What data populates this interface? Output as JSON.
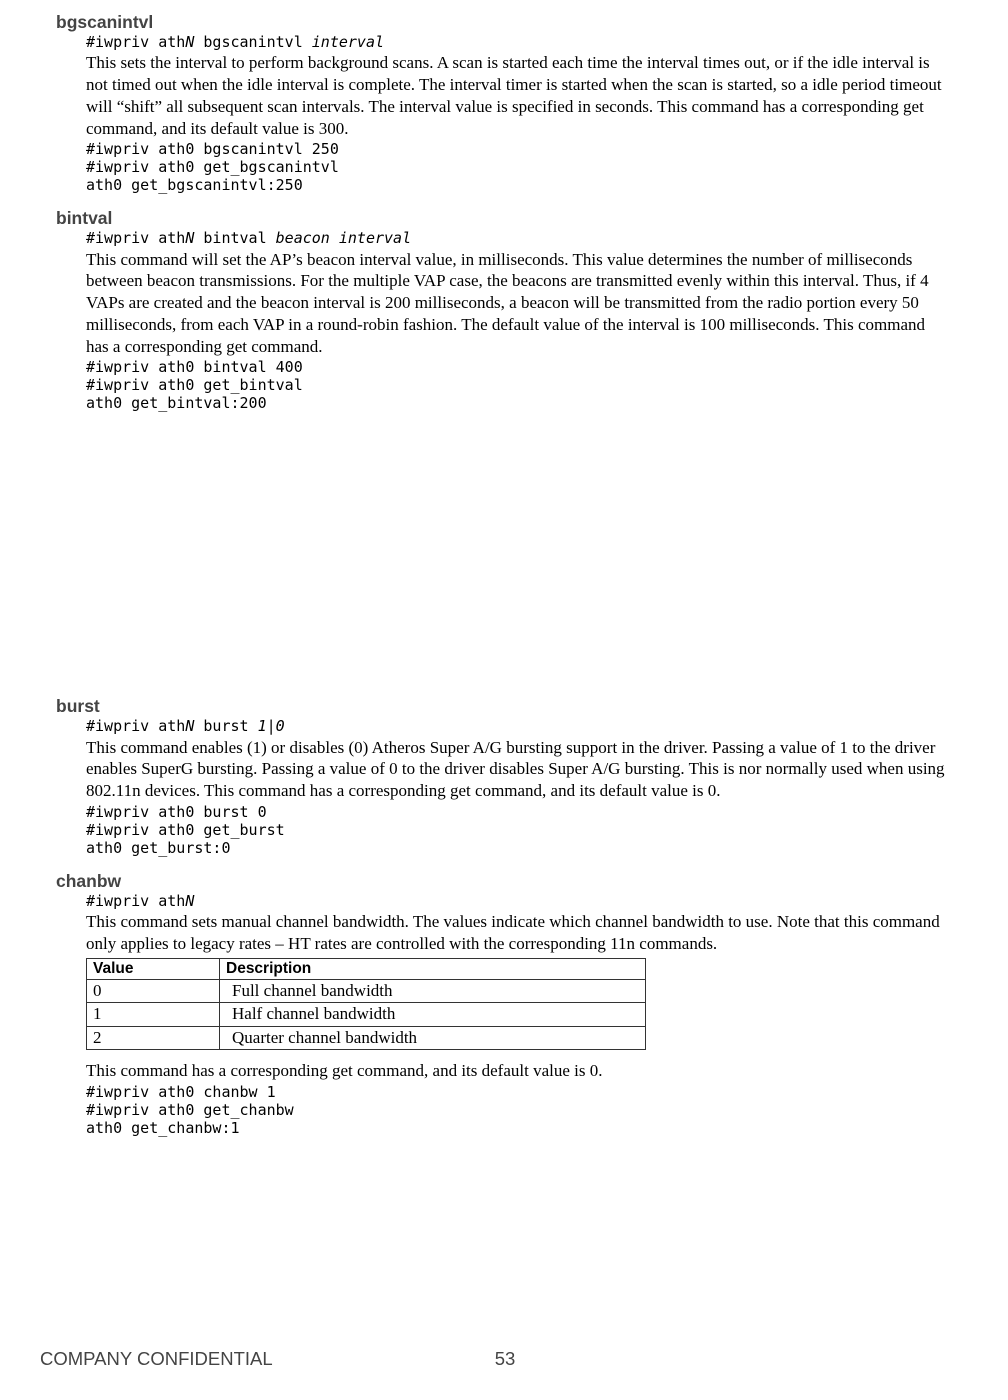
{
  "sections": {
    "bgscanintvl": {
      "heading": "bgscanintvl",
      "syntax_pre": "#iwpriv ath",
      "syntax_n": "N",
      "syntax_mid": " bgscanintvl ",
      "syntax_arg": "interval",
      "desc": "This sets the interval to perform background scans. A scan is started each time the interval times out, or if the idle interval is not timed out when the idle interval is complete. The interval timer is started when the scan is started, so a idle period timeout will “shift” all subsequent scan intervals. The interval value is specified in seconds. This command has a corresponding get command, and its default value is 300.",
      "example": "#iwpriv ath0 bgscanintvl 250\n#iwpriv ath0 get_bgscanintvl\nath0 get_bgscanintvl:250"
    },
    "bintval": {
      "heading": "bintval",
      "syntax_pre": "#iwpriv ath",
      "syntax_n": "N",
      "syntax_mid": " bintval ",
      "syntax_arg": "beacon interval",
      "desc": "This command will set the AP’s beacon interval value, in milliseconds. This value determines the number of milliseconds between beacon transmissions. For the multiple VAP case, the beacons are transmitted evenly within this interval. Thus, if 4 VAPs are created and the beacon interval is 200 milliseconds, a beacon will be transmitted from the radio portion every 50 milliseconds, from each VAP in a round-robin fashion. The default value of the interval is 100 milliseconds. This command has a corresponding get command.",
      "example": "#iwpriv ath0 bintval 400\n#iwpriv ath0 get_bintval\nath0 get_bintval:200"
    },
    "burst": {
      "heading": "burst",
      "syntax_pre": "#iwpriv ath",
      "syntax_n": "N",
      "syntax_mid": " burst ",
      "syntax_arg": "1|0",
      "desc": "This command enables (1) or disables (0) Atheros Super A/G bursting support in the driver. Passing a value of 1 to the driver enables SuperG bursting. Passing a value of 0 to the driver disables Super A/G bursting. This is nor normally used when using 802.11n devices. This command has a corresponding get command, and its default value is 0.",
      "example": "#iwpriv ath0 burst 0\n#iwpriv ath0 get_burst\nath0 get_burst:0"
    },
    "chanbw": {
      "heading": "chanbw",
      "syntax_pre": "#iwpriv ath",
      "syntax_n": "N",
      "desc": "This command sets manual channel bandwidth. The values indicate which channel bandwidth to use. Note that this command only applies to legacy rates – HT rates are controlled with the corresponding 11n commands.",
      "table": {
        "head_value": "Value",
        "head_desc": "Description",
        "rows": [
          {
            "value": "0",
            "desc": "Full channel bandwidth"
          },
          {
            "value": "1",
            "desc": "Half channel bandwidth"
          },
          {
            "value": "2",
            "desc": "Quarter channel bandwidth"
          }
        ]
      },
      "desc2": "This command has a corresponding get command, and its default value is 0.",
      "example": "#iwpriv ath0 chanbw 1\n#iwpriv ath0 get_chanbw\nath0 get_chanbw:1"
    }
  },
  "footer": {
    "label": "COMPANY CONFIDENTIAL",
    "page": "53"
  }
}
